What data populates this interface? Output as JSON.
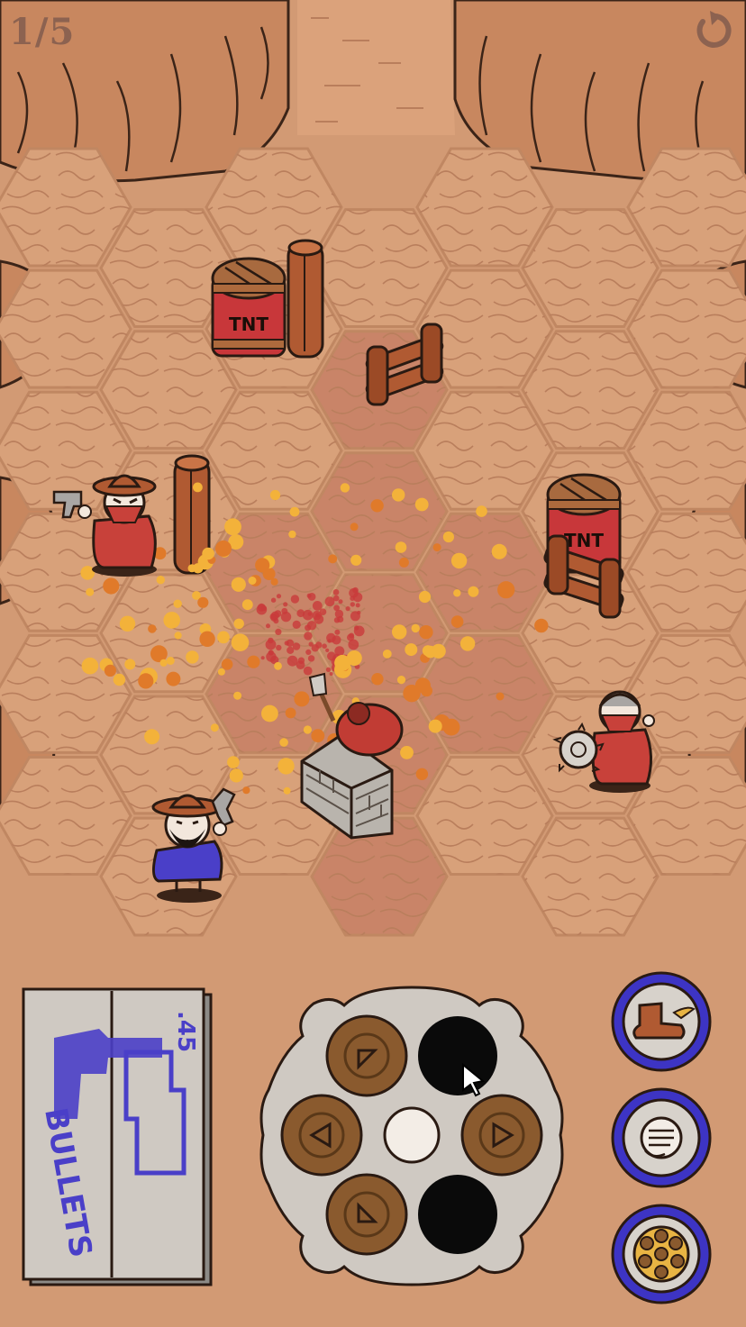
{
  "hud": {
    "level_progress": "1/5",
    "restart_icon": "restart-arrow-icon"
  },
  "board": {
    "crates": [
      "TNT",
      "TNT"
    ]
  },
  "ammo_box": {
    "caliber": ".45",
    "label": "BULLETS"
  },
  "cylinder": {
    "chambers": [
      {
        "slot": "top-left",
        "state": "loaded",
        "direction": "up-left"
      },
      {
        "slot": "top-right",
        "state": "empty"
      },
      {
        "slot": "left",
        "state": "loaded",
        "direction": "left"
      },
      {
        "slot": "right",
        "state": "loaded",
        "direction": "right"
      },
      {
        "slot": "bottom-left",
        "state": "loaded",
        "direction": "down-left"
      },
      {
        "slot": "bottom-right",
        "state": "empty"
      }
    ]
  },
  "actions": [
    {
      "name": "boot-kick",
      "icon": "winged-boot-icon"
    },
    {
      "name": "punch",
      "icon": "fist-icon"
    },
    {
      "name": "reload",
      "icon": "revolver-cylinder-icon"
    }
  ],
  "colors": {
    "background": "#d29a74",
    "hex_tile": "#d8a17a",
    "hex_red": "#c98468",
    "outline": "#2a1a12",
    "enemy_red": "#c8413a",
    "player_blue": "#4a3fc8",
    "button_blue": "#3d34c4"
  }
}
